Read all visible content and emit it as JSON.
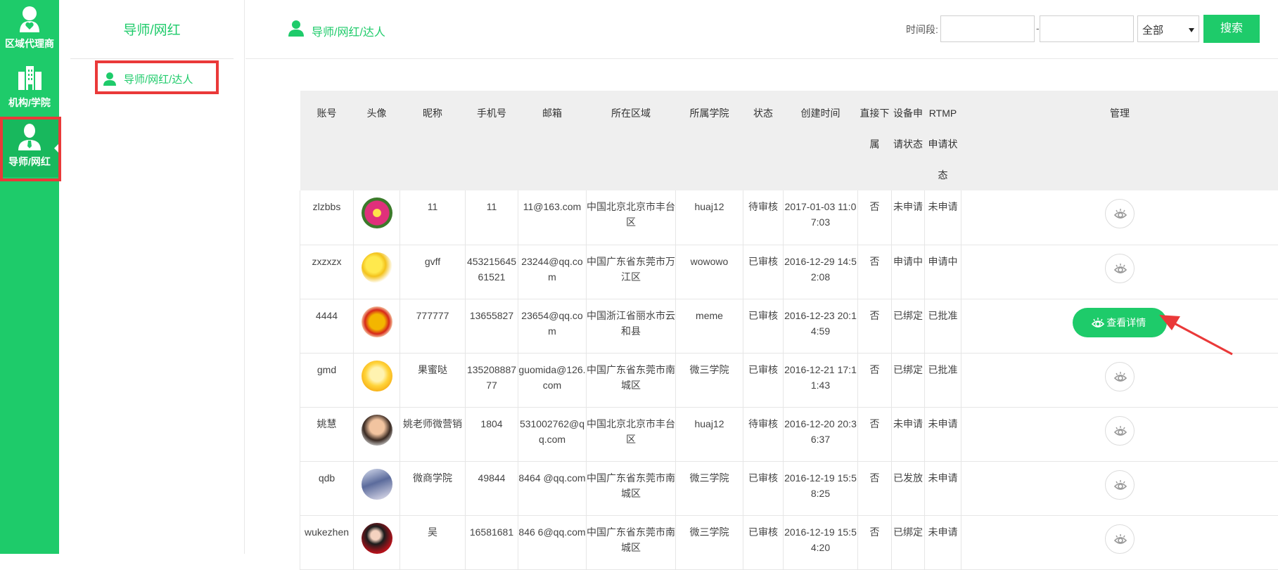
{
  "rail": {
    "items": [
      {
        "label": "区域代理商",
        "icon": "user-heart-icon"
      },
      {
        "label": "机构/学院",
        "icon": "building-icon"
      },
      {
        "label": "导师/网红",
        "icon": "user-tie-icon",
        "active": true
      }
    ]
  },
  "subnav": {
    "title": "导师/网红",
    "items": [
      {
        "label": "导师/网红/达人",
        "icon": "person-icon"
      }
    ]
  },
  "header": {
    "breadcrumb": "导师/网红/达人",
    "filter_label": "时间段:",
    "date_from": "",
    "date_to": "",
    "dash": "-",
    "status_select": "全部",
    "search_button": "搜索"
  },
  "table": {
    "columns": [
      "账号",
      "头像",
      "昵称",
      "手机号",
      "邮箱",
      "所在区域",
      "所属学院",
      "状态",
      "创建时间",
      "直接下属",
      "设备申请状态",
      "RTMP申请状态",
      "管理"
    ],
    "detail_button": "查看详情",
    "rows": [
      {
        "account": "zlzbbs",
        "nickname": "11",
        "phone": "11",
        "email": "11@163.com",
        "region": "中国北京北京市丰台区",
        "college": "huaj12",
        "status": "待审核",
        "created": "2017-01-03 11:07:03",
        "subordinate": "否",
        "device": "未申请",
        "rtmp": "未申请"
      },
      {
        "account": "zxzxzx",
        "nickname": "gvff",
        "phone": "45321564561521",
        "email": "23244@qq.com",
        "region": "中国广东省东莞市万江区",
        "college": "wowowo",
        "status": "已审核",
        "created": "2016-12-29 14:52:08",
        "subordinate": "否",
        "device": "申请中",
        "rtmp": "申请中"
      },
      {
        "account": "4444",
        "nickname": "777777",
        "phone": "13655827",
        "email": "23654@qq.com",
        "region": "中国浙江省丽水市云和县",
        "college": "meme",
        "status": "已审核",
        "created": "2016-12-23 20:14:59",
        "subordinate": "否",
        "device": "已绑定",
        "rtmp": "已批准",
        "highlighted": true
      },
      {
        "account": "gmd",
        "nickname": "果蜜哒",
        "phone": "13520888777",
        "email": "guomida@126.com",
        "region": "中国广东省东莞市南城区",
        "college": "微三学院",
        "status": "已审核",
        "created": "2016-12-21 17:11:43",
        "subordinate": "否",
        "device": "已绑定",
        "rtmp": "已批准"
      },
      {
        "account": "姚慧",
        "nickname": "姚老师微营销",
        "phone": "1804",
        "email": "531002762@qq.com",
        "region": "中国北京北京市丰台区",
        "college": "huaj12",
        "status": "待审核",
        "created": "2016-12-20 20:36:37",
        "subordinate": "否",
        "device": "未申请",
        "rtmp": "未申请"
      },
      {
        "account": "qdb",
        "nickname": "微商学院",
        "phone": "49844",
        "email": "8464 @qq.com",
        "region": "中国广东省东莞市南城区",
        "college": "微三学院",
        "status": "已审核",
        "created": "2016-12-19 15:58:25",
        "subordinate": "否",
        "device": "已发放",
        "rtmp": "未申请"
      },
      {
        "account": "wukezhen",
        "nickname": "吴",
        "phone": "16581681",
        "email": "846 6@qq.com",
        "region": "中国广东省东莞市南城区",
        "college": "微三学院",
        "status": "已审核",
        "created": "2016-12-19 15:54:20",
        "subordinate": "否",
        "device": "已绑定",
        "rtmp": "未申请"
      }
    ]
  },
  "colors": {
    "brand": "#1ecb6a",
    "annotation": "#ea3939"
  }
}
